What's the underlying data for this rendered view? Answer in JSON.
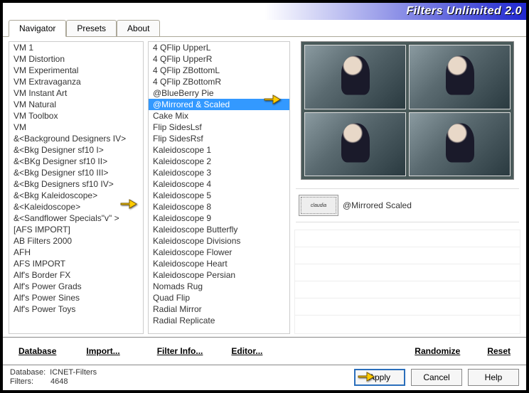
{
  "title": "Filters Unlimited 2.0",
  "tabs": [
    {
      "label": "Navigator",
      "active": true
    },
    {
      "label": "Presets",
      "active": false
    },
    {
      "label": "About",
      "active": false
    }
  ],
  "list1": [
    "VM 1",
    "VM Distortion",
    "VM Experimental",
    "VM Extravaganza",
    "VM Instant Art",
    "VM Natural",
    "VM Toolbox",
    "VM",
    "&<Background Designers IV>",
    "&<Bkg Designer sf10 I>",
    "&<BKg Designer sf10 II>",
    "&<Bkg Designer sf10 III>",
    "&<Bkg Designers sf10 IV>",
    "&<Bkg Kaleidoscope>",
    "&<Kaleidoscope>",
    "&<Sandflower Specials\"v\" >",
    "[AFS IMPORT]",
    "AB Filters 2000",
    "AFH",
    "AFS IMPORT",
    "Alf's Border FX",
    "Alf's Power Grads",
    "Alf's Power Sines",
    "Alf's Power Toys"
  ],
  "list1_highlight": "&<Bkg Kaleidoscope>",
  "list2": [
    "4 QFlip UpperL",
    "4 QFlip UpperR",
    "4 QFlip ZBottomL",
    "4 QFlip ZBottomR",
    "@BlueBerry Pie",
    "@Mirrored & Scaled",
    "Cake Mix",
    "Flip SidesLsf",
    "Flip SidesRsf",
    "Kaleidoscope 1",
    "Kaleidoscope 2",
    "Kaleidoscope 3",
    "Kaleidoscope 4",
    "Kaleidoscope 5",
    "Kaleidoscope 8",
    "Kaleidoscope 9",
    "Kaleidoscope Butterfly",
    "Kaleidoscope Divisions",
    "Kaleidoscope Flower",
    "Kaleidoscope Heart",
    "Kaleidoscope Persian",
    "Nomads Rug",
    "Quad Flip",
    "Radial Mirror",
    "Radial Replicate"
  ],
  "list2_selected": "@Mirrored & Scaled",
  "stamp_text": "claudia",
  "filter_name": "@Mirrored  Scaled",
  "actions": {
    "database": "Database",
    "import": "Import...",
    "filterinfo": "Filter Info...",
    "editor": "Editor...",
    "randomize": "Randomize",
    "reset": "Reset"
  },
  "footer": {
    "db_label": "Database:",
    "db_value": "ICNET-Filters",
    "filters_label": "Filters:",
    "filters_value": "4648",
    "apply": "Apply",
    "cancel": "Cancel",
    "help": "Help"
  }
}
